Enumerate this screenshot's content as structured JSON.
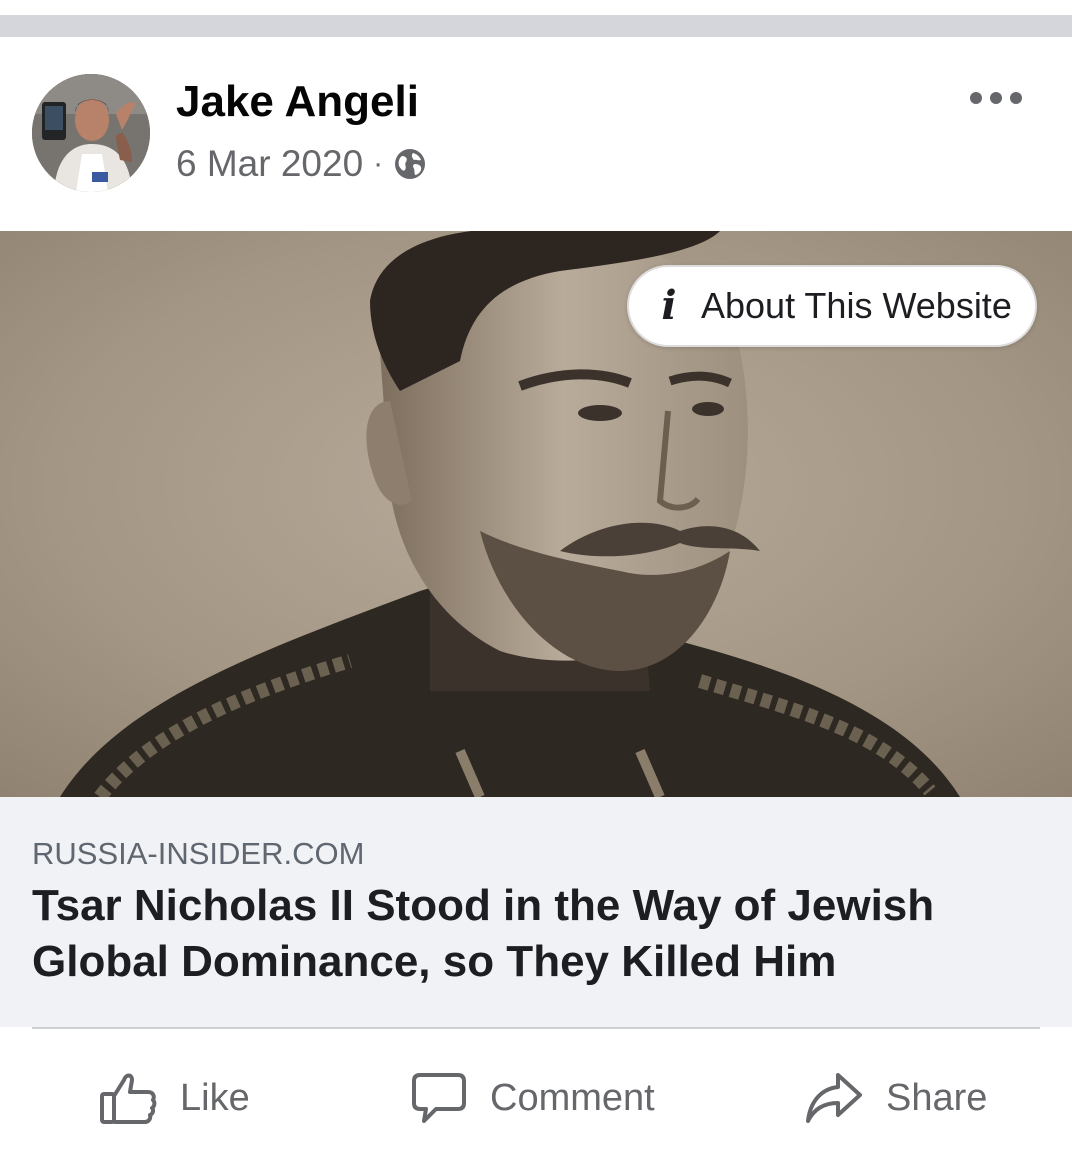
{
  "post": {
    "author_name": "Jake Angeli",
    "date": "6 Mar 2020",
    "separator": "·",
    "audience_icon": "globe-icon",
    "more_icon": "more-horizontal-icon"
  },
  "link_preview": {
    "about_label": "About This Website",
    "about_icon": "info-icon",
    "about_icon_glyph": "i",
    "domain": "RUSSIA-INSIDER.COM",
    "title": "Tsar Nicholas II Stood in the Way of Jewish Global Dominance, so They Killed Him"
  },
  "actions": {
    "like": "Like",
    "comment": "Comment",
    "share": "Share"
  },
  "colors": {
    "divider_band": "#d4d6dc",
    "name_text": "#050505",
    "meta_text": "#65676b",
    "preview_background": "#f0f2f5",
    "domain_text": "#606770",
    "title_text": "#1c1e21"
  }
}
